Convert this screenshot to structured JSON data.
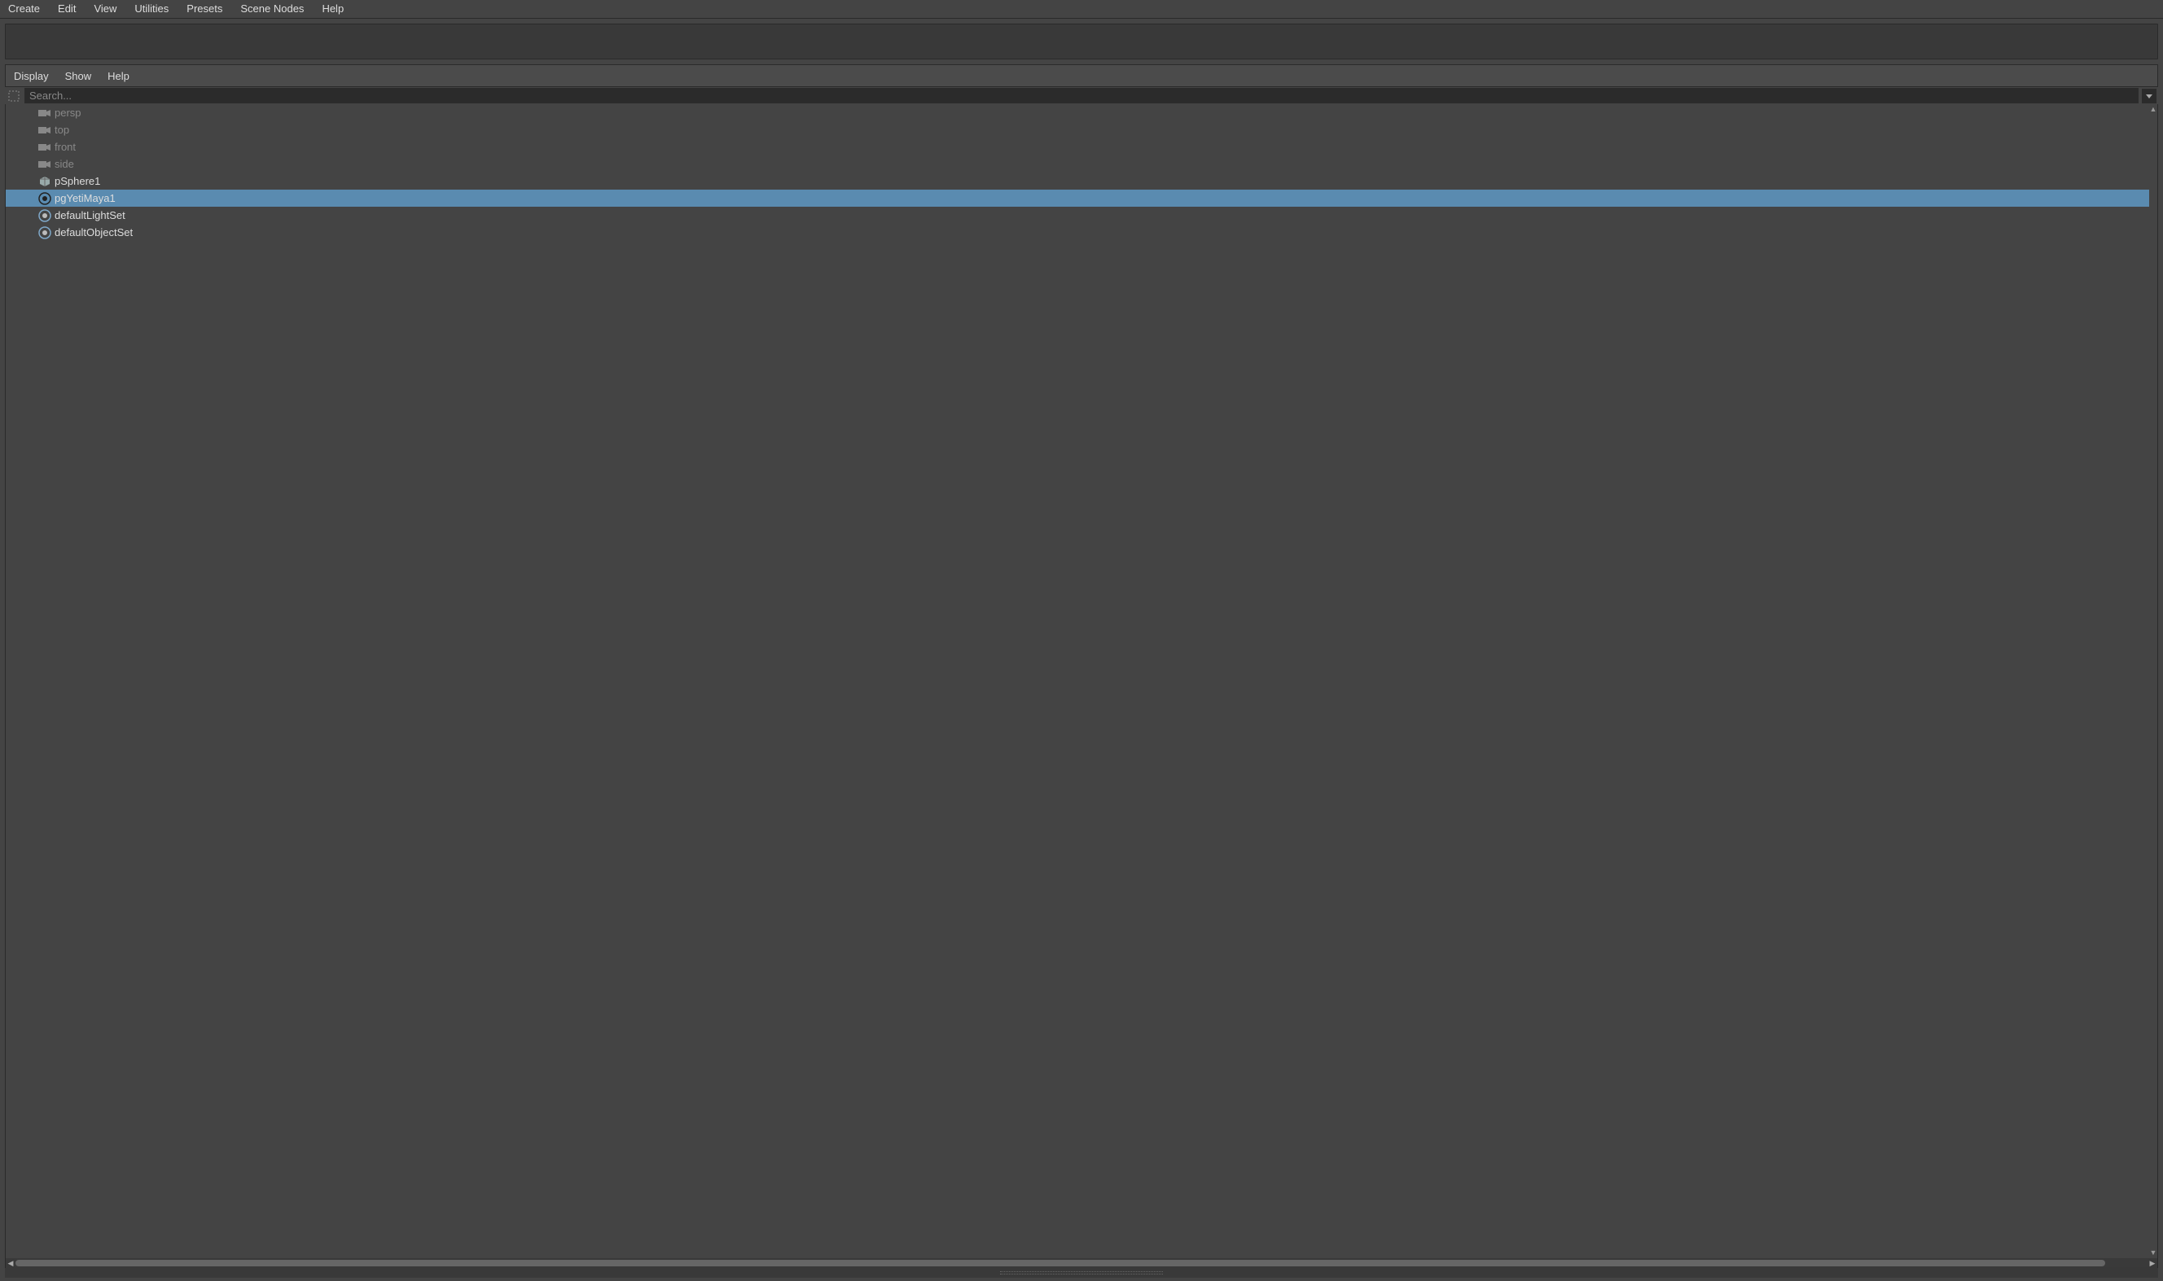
{
  "topMenu": {
    "create": "Create",
    "edit": "Edit",
    "view": "View",
    "utilities": "Utilities",
    "presets": "Presets",
    "sceneNodes": "Scene Nodes",
    "help": "Help"
  },
  "panelMenu": {
    "display": "Display",
    "show": "Show",
    "help": "Help"
  },
  "search": {
    "placeholder": "Search..."
  },
  "outliner": {
    "items": [
      {
        "label": "persp",
        "icon": "camera",
        "dim": true,
        "selected": false
      },
      {
        "label": "top",
        "icon": "camera",
        "dim": true,
        "selected": false
      },
      {
        "label": "front",
        "icon": "camera",
        "dim": true,
        "selected": false
      },
      {
        "label": "side",
        "icon": "camera",
        "dim": true,
        "selected": false
      },
      {
        "label": "pSphere1",
        "icon": "mesh",
        "dim": false,
        "selected": false
      },
      {
        "label": "pgYetiMaya1",
        "icon": "yeti",
        "dim": false,
        "selected": true
      },
      {
        "label": "defaultLightSet",
        "icon": "set",
        "dim": false,
        "selected": false
      },
      {
        "label": "defaultObjectSet",
        "icon": "set",
        "dim": false,
        "selected": false
      }
    ]
  }
}
